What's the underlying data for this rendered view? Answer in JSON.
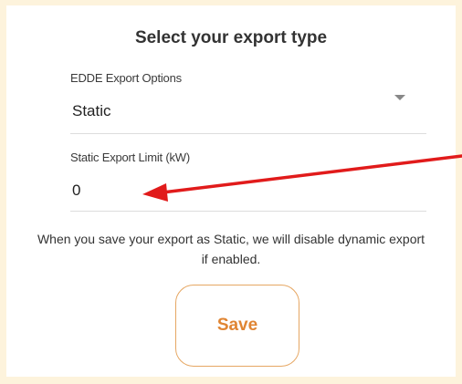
{
  "page": {
    "title": "Select your export type",
    "notice": "When you save your export as Static, we will disable dynamic export if enabled."
  },
  "export_options": {
    "label": "EDDE Export Options",
    "selected": "Static",
    "icon": "chevron-down-icon"
  },
  "static_limit": {
    "label": "Static Export Limit (kW)",
    "value": "0"
  },
  "save_button": {
    "label": "Save"
  },
  "colors": {
    "background": "#fdf3dc",
    "accent": "#e08533",
    "annotation_arrow": "#e11b1b"
  }
}
